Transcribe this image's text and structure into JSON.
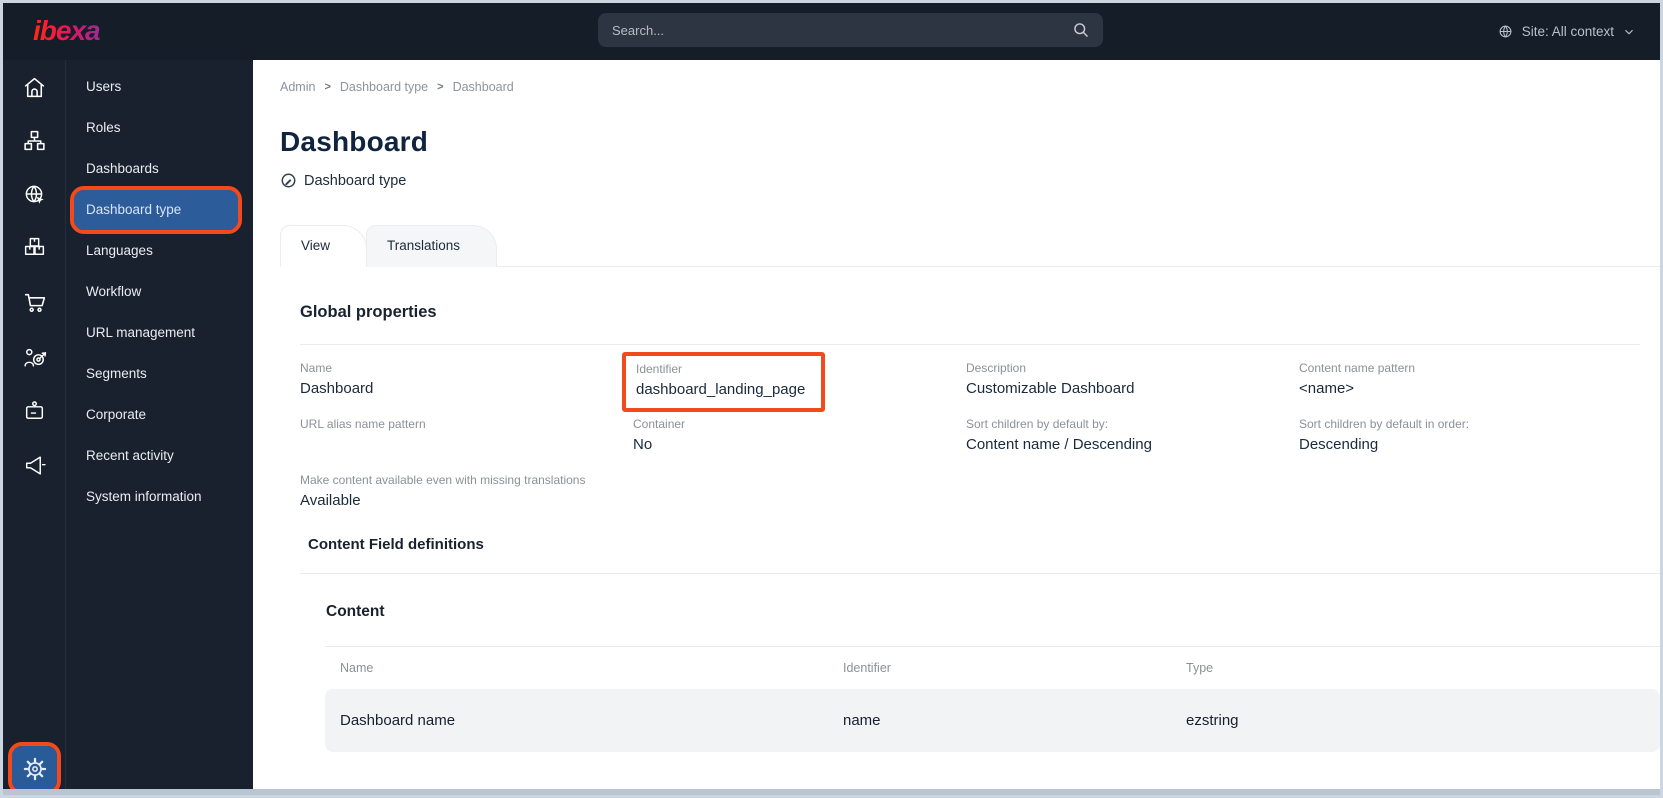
{
  "topbar": {
    "logo": "ibexa",
    "search_placeholder": "Search...",
    "site_context": "Site: All context"
  },
  "sidebar": {
    "rail_icons": [
      "home",
      "content-tree",
      "site",
      "products",
      "commerce",
      "personalization",
      "corporate",
      "marketing"
    ],
    "settings_icon": "settings-gear",
    "menu_items": [
      "Users",
      "Roles",
      "Dashboards",
      "Dashboard type",
      "Languages",
      "Workflow",
      "URL management",
      "Segments",
      "Corporate",
      "Recent activity",
      "System information"
    ],
    "selected_item": "Dashboard type"
  },
  "breadcrumb": {
    "items": [
      "Admin",
      "Dashboard type",
      "Dashboard"
    ],
    "separator": ">"
  },
  "page": {
    "title": "Dashboard",
    "subtitle": "Dashboard type",
    "tabs": [
      "View",
      "Translations"
    ],
    "active_tab": "View"
  },
  "global_properties": {
    "heading": "Global properties",
    "fields": [
      {
        "label": "Name",
        "value": "Dashboard"
      },
      {
        "label": "Identifier",
        "value": "dashboard_landing_page",
        "highlighted": true
      },
      {
        "label": "Description",
        "value": "Customizable Dashboard"
      },
      {
        "label": "Content name pattern",
        "value": "<name>"
      },
      {
        "label": "URL alias name pattern",
        "value": ""
      },
      {
        "label": "Container",
        "value": "No"
      },
      {
        "label": "Sort children by default by:",
        "value": "Content name / Descending"
      },
      {
        "label": "Sort children by default in order:",
        "value": "Descending"
      },
      {
        "label": "Make content available even with missing translations",
        "value": "Available"
      }
    ]
  },
  "field_definitions": {
    "heading": "Content Field definitions",
    "group_heading": "Content",
    "table": {
      "headers": [
        "Name",
        "Identifier",
        "Type"
      ],
      "rows": [
        [
          "Dashboard name",
          "name",
          "ezstring"
        ]
      ]
    }
  },
  "colors": {
    "annotation_orange": "#f2491d",
    "selected_blue": "#2c5c9a",
    "topbar_bg": "#141d28",
    "sidebar_bg": "#18212d",
    "row_bg": "#f2f3f5"
  }
}
